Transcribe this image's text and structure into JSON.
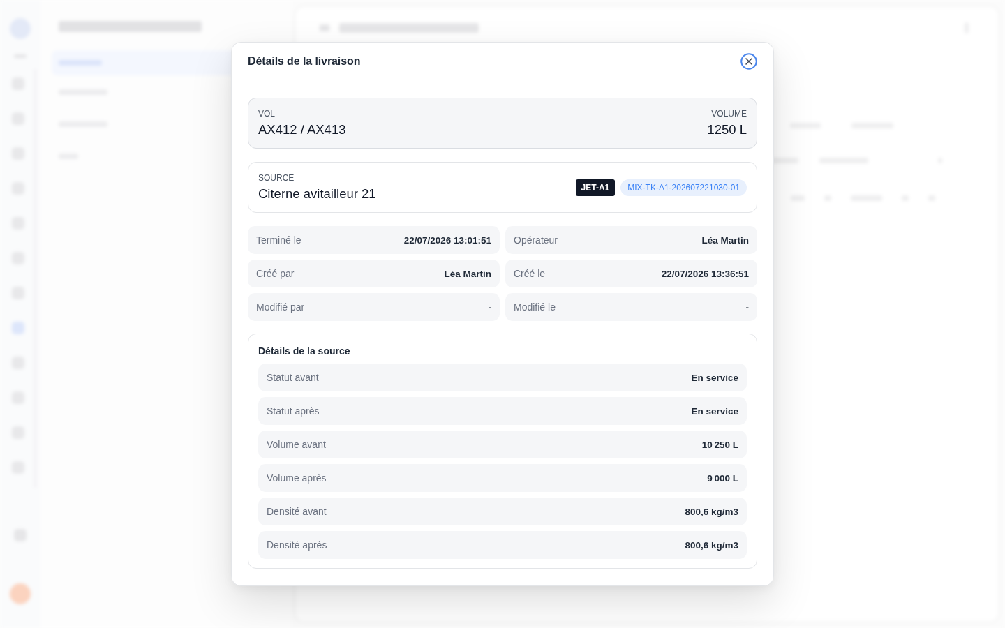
{
  "dialog": {
    "title": "Détails de la livraison",
    "summary": {
      "flight": {
        "label": "VOL",
        "value": "AX412 / AX413"
      },
      "volume": {
        "label": "VOLUME",
        "value": "1250 L"
      }
    },
    "source": {
      "label": "SOURCE",
      "name": "Citerne avitailleur 21",
      "badges": [
        {
          "kind": "product",
          "text": "JET-A1"
        },
        {
          "kind": "batch",
          "text": "MIX-TK-A1-202607221030-01"
        }
      ]
    },
    "fields": [
      {
        "label": "Terminé le",
        "value": "22/07/2026 13:01:51"
      },
      {
        "label": "Opérateur",
        "value": "Léa Martin"
      },
      {
        "label": "Créé par",
        "value": "Léa Martin"
      },
      {
        "label": "Créé le",
        "value": "22/07/2026 13:36:51"
      },
      {
        "label": "Modifié par",
        "value": "-"
      },
      {
        "label": "Modifié le",
        "value": "-"
      }
    ],
    "source_details": {
      "title": "Détails de la source",
      "rows": [
        {
          "label": "Statut avant",
          "value": "En service"
        },
        {
          "label": "Statut après",
          "value": "En service"
        },
        {
          "label": "Volume avant",
          "value": "10 250 L"
        },
        {
          "label": "Volume après",
          "value": "9 000 L"
        },
        {
          "label": "Densité avant",
          "value": "800,6 kg/m3"
        },
        {
          "label": "Densité après",
          "value": "800,6 kg/m3"
        }
      ]
    }
  }
}
